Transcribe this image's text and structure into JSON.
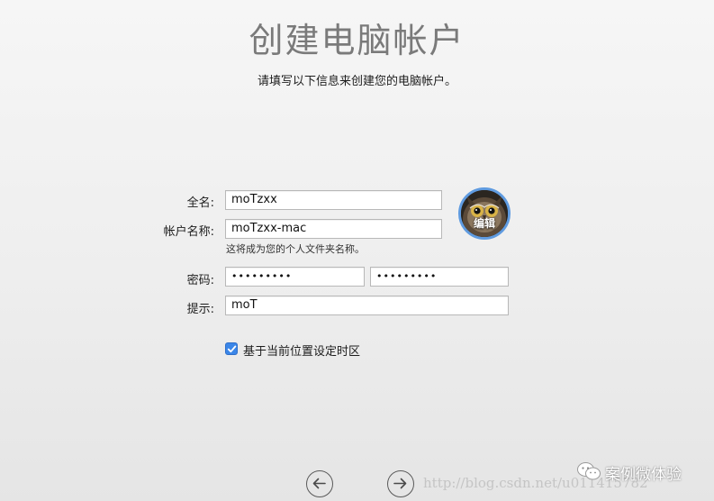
{
  "header": {
    "title": "创建电脑帐户",
    "subtitle": "请填写以下信息来创建您的电脑帐户。"
  },
  "form": {
    "full_name_label": "全名:",
    "full_name_value": "moTzxx",
    "account_name_label": "帐户名称:",
    "account_name_value": "moTzxx-mac",
    "account_name_helper": "这将成为您的个人文件夹名称。",
    "password_label": "密码:",
    "password_value": "•••••••••",
    "verify_value": "•••••••••",
    "hint_label": "提示:",
    "hint_value": "moT"
  },
  "avatar": {
    "edit_label": "编辑"
  },
  "timezone_option": {
    "label": "基于当前位置设定时区",
    "checked": true
  },
  "navigation": {
    "back_icon": "arrow-left-circle-icon",
    "continue_icon": "arrow-right-circle-icon"
  },
  "overlay": {
    "watermark": "http://blog.csdn.net/u011415782",
    "brand_text": "案例微体验",
    "brand_icon": "wechat-icon"
  },
  "colors": {
    "accent": "#3b86e8",
    "avatar_ring": "#5f9be0",
    "title_gray": "#7a7a7a"
  }
}
